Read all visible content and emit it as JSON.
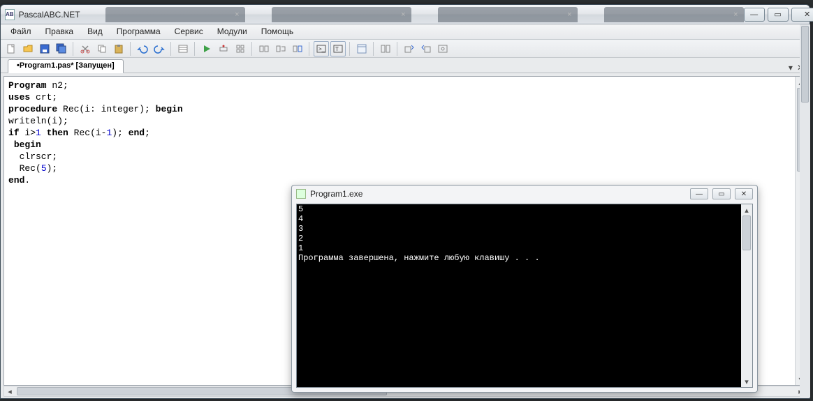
{
  "app": {
    "title": "PascalABC.NET",
    "ghost_tabs": [
      "",
      "",
      "",
      ""
    ],
    "window_controls": {
      "min": "—",
      "max": "▭",
      "close": "✕"
    }
  },
  "menu": [
    "Файл",
    "Правка",
    "Вид",
    "Программа",
    "Сервис",
    "Модули",
    "Помощь"
  ],
  "toolbar_icons": [
    "new-file-icon",
    "open-file-icon",
    "save-icon",
    "save-all-icon",
    "sep",
    "cut-icon",
    "copy-icon",
    "paste-icon",
    "sep",
    "undo-icon",
    "redo-icon",
    "sep",
    "properties-icon",
    "sep",
    "run-icon",
    "step-over-icon",
    "step-into-icon",
    "sep",
    "stop-icon",
    "pause-icon",
    "debug-icon",
    "sep",
    "terminal-in-icon",
    "terminal-out-icon",
    "sep",
    "form-design-icon",
    "sep",
    "module-icon",
    "sep",
    "module-import-icon",
    "module-export-icon",
    "module-config-icon"
  ],
  "doc_tab": "•Program1.pas* [Запущен]",
  "tab_controls": {
    "dropdown": "▾",
    "close": "✕"
  },
  "code_lines": [
    {
      "t": "plain",
      "s": "Program n2;"
    },
    {
      "t": "uses",
      "s": "uses crt;"
    },
    {
      "t": "proc",
      "s": "procedure Rec(i: integer); begin"
    },
    {
      "t": "plain",
      "s": "writeln(i);"
    },
    {
      "t": "ifline",
      "s": "if i>1 then Rec(i-1); end;"
    },
    {
      "t": "kw",
      "s": " begin"
    },
    {
      "t": "plain",
      "s": "  clrscr;"
    },
    {
      "t": "call",
      "s": "  Rec(5);"
    },
    {
      "t": "kw",
      "s": "end."
    }
  ],
  "console": {
    "title": "Program1.exe",
    "lines": [
      "5",
      "4",
      "3",
      "2",
      "1",
      "Программа завершена, нажмите любую клавишу . . ."
    ],
    "controls": {
      "min": "—",
      "max": "▭",
      "close": "✕"
    }
  }
}
